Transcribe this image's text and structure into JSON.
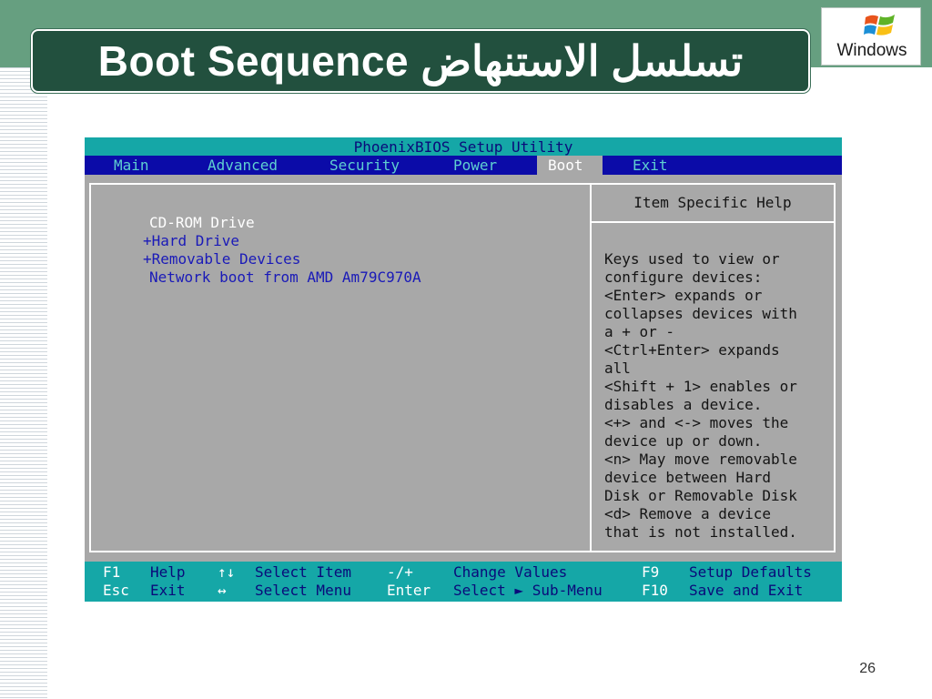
{
  "slide": {
    "title": "Boot Sequence تسلسل الاستنهاض",
    "logo_text": "Windows",
    "page_number": "26"
  },
  "bios": {
    "title": "PhoenixBIOS Setup Utility",
    "menu": [
      "Main",
      "Advanced",
      "Security",
      "Power",
      "Boot",
      "Exit"
    ],
    "active_menu": "Boot",
    "boot_items": [
      "CD-ROM Drive",
      "+Hard Drive",
      "+Removable Devices",
      "Network boot from AMD Am79C970A"
    ],
    "help_title": "Item Specific Help",
    "help_lines": [
      "Keys used to view or",
      "configure devices:",
      "<Enter> expands or",
      "collapses devices with",
      "a + or -",
      "<Ctrl+Enter> expands",
      "all",
      "<Shift + 1> enables or",
      "disables a device.",
      "<+> and <-> moves the",
      "device up or down.",
      "<n> May move removable",
      "device between Hard",
      "Disk or Removable Disk",
      "<d> Remove a device",
      "that is not installed."
    ],
    "footer": {
      "row1": {
        "k1": "F1",
        "d1": "Help",
        "k2": "↑↓",
        "d2": "Select Item",
        "k3": "-/+",
        "d3": "Change Values",
        "k4": "F9",
        "d4": "Setup Defaults"
      },
      "row2": {
        "k1": "Esc",
        "d1": "Exit",
        "k2": "↔",
        "d2": "Select Menu",
        "k3": "Enter",
        "d3": "Select ► Sub-Menu",
        "k4": "F10",
        "d4": "Save and Exit"
      }
    }
  },
  "colors": {
    "bios_gray": "#a8a8a8",
    "bios_blue": "#0b0ba8",
    "bios_cyan": "#15a7a7",
    "slide_green": "#669f80",
    "title_green": "#22503e"
  }
}
